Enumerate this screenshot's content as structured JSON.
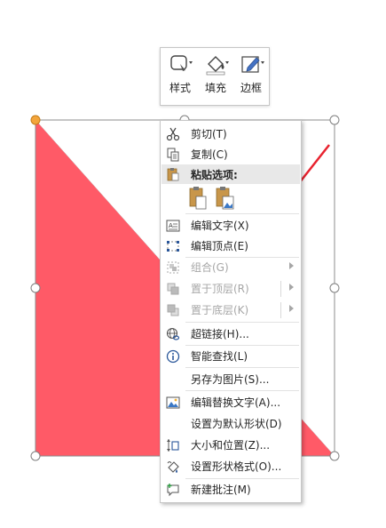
{
  "mini_toolbar": {
    "buttons": [
      {
        "label": "样式",
        "icon": "shape-style-icon"
      },
      {
        "label": "填充",
        "icon": "paint-bucket-icon"
      },
      {
        "label": "边框",
        "icon": "pen-outline-icon"
      }
    ]
  },
  "context_menu": {
    "cut": "剪切(T)",
    "copy": "复制(C)",
    "paste_options": "粘贴选项:",
    "edit_text": "编辑文字(X)",
    "edit_points": "编辑顶点(E)",
    "group": "组合(G)",
    "bring_to_front": "置于顶层(R)",
    "send_to_back": "置于底层(K)",
    "hyperlink": "超链接(H)...",
    "smart_lookup": "智能查找(L)",
    "save_as_picture": "另存为图片(S)...",
    "edit_alt_text": "编辑替换文字(A)...",
    "set_default_shape": "设置为默认形状(D)",
    "size_and_position": "大小和位置(Z)...",
    "format_shape": "设置形状格式(O)...",
    "new_comment": "新建批注(M)"
  },
  "colors": {
    "shape_fill": "#ff5a67",
    "annotation_arrow": "#e8232f",
    "selection_handle_fill": "#ffffff",
    "vertex_handle": "#f3a53b"
  }
}
